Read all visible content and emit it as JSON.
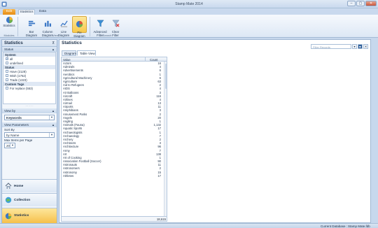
{
  "window": {
    "title": "Stamp Mate 2014",
    "minimize": "–",
    "maximize": "▢",
    "close": "✕"
  },
  "ribbon": {
    "file_tab": "Edit",
    "tabs": [
      "Statistics",
      "Data"
    ],
    "buttons": {
      "statistics": "Statistics",
      "bar": "Bar\nDiagram",
      "column": "Column\nDiagram",
      "line": "Line\nDiagram",
      "pie": "Pie\nDiagram",
      "advanced_filter": "Advanced\nFilter",
      "clear_filter": "Clear\nFilter"
    },
    "groups": {
      "modules": "Modules",
      "view": "View",
      "search": "Search"
    }
  },
  "left": {
    "title": "Statistics",
    "pin": "⊼",
    "filter_section": "Status",
    "tree": [
      {
        "group": "System",
        "items": [
          {
            "label": "all",
            "checked": true
          },
          {
            "label": "undefined",
            "checked": false
          }
        ]
      },
      {
        "group": "Status",
        "items": [
          {
            "label": "Have (2128)",
            "checked": false
          },
          {
            "label": "Wish (1762)",
            "checked": false
          },
          {
            "label": "Trade (1323)",
            "checked": false
          }
        ]
      },
      {
        "group": "Custom Tags",
        "items": [
          {
            "label": "For replace (553)",
            "checked": false
          }
        ]
      }
    ],
    "view_by_label": "View by",
    "view_by_value": "Keywords",
    "view_params_label": "View Parameters",
    "sort_by_label": "Sort By",
    "sort_by_value": "by Name",
    "max_items_label": "Max Items per Page",
    "max_items_value": "20",
    "nav": [
      {
        "label": "Home",
        "icon": "home-icon"
      },
      {
        "label": "Collection",
        "icon": "collection-icon"
      },
      {
        "label": "Statistics",
        "icon": "statistics-icon"
      }
    ]
  },
  "main": {
    "title": "Statistics",
    "filter_placeholder": "Filter Records",
    "view_tabs": [
      "Diagram",
      "Table View"
    ],
    "active_view_tab": "Table View",
    "columns": [
      "Value",
      "Count"
    ],
    "rows": [
      [
        "Actors",
        "16"
      ],
      [
        "Admirals",
        "4"
      ],
      [
        "Advertisements",
        "6"
      ],
      [
        "Aerobics",
        "1"
      ],
      [
        "Agricultural Machinery",
        "6"
      ],
      [
        "Agriculture",
        "63"
      ],
      [
        "Aid to Refugees",
        "2"
      ],
      [
        "AIDS",
        "4"
      ],
      [
        "Air Balloons",
        "3"
      ],
      [
        "Aircraft",
        "116"
      ],
      [
        "Airlines",
        "4"
      ],
      [
        "Airmail",
        "13"
      ],
      [
        "Airports",
        "11"
      ],
      [
        "Amphibians",
        "3"
      ],
      [
        "Amusement Parks",
        "2"
      ],
      [
        "Angels",
        "20"
      ],
      [
        "Angling",
        "1"
      ],
      [
        "Animals (Fauna)",
        "1,132"
      ],
      [
        "Aquatic Sports",
        "17"
      ],
      [
        "Archaeologists",
        "1"
      ],
      [
        "Archaeology",
        "7"
      ],
      [
        "Archery",
        "2"
      ],
      [
        "Architects",
        "3"
      ],
      [
        "Architecture",
        "96"
      ],
      [
        "Army",
        "7"
      ],
      [
        "Art",
        "138"
      ],
      [
        "Art of Cooking",
        "1"
      ],
      [
        "Association Football (Soccer)",
        "90"
      ],
      [
        "Astronauts",
        "11"
      ],
      [
        "Astronomers",
        "2"
      ],
      [
        "Astronomy",
        "15"
      ],
      [
        "Athletes",
        "17"
      ]
    ],
    "total": "18,615"
  },
  "status": {
    "current_db": "Current Database :",
    "db_name": "Stamp Mate.fdb"
  },
  "colors": {
    "accent": "#f6c04a",
    "frame": "#c7d8ed",
    "header": "#1b2f48"
  }
}
